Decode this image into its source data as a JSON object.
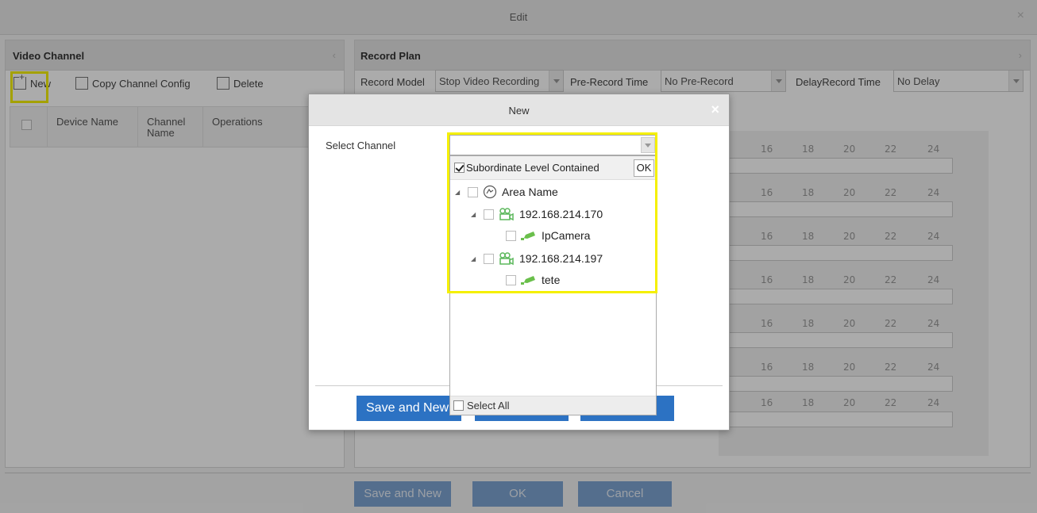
{
  "dialog": {
    "title": "Edit",
    "close": "×"
  },
  "left_panel": {
    "title": "Video Channel",
    "toolbar": {
      "new": "New",
      "copy": "Copy Channel Config",
      "delete": "Delete"
    },
    "columns": [
      "Device Name",
      "Channel Name",
      "Operations"
    ]
  },
  "right_panel": {
    "title": "Record Plan",
    "record_model_label": "Record Model",
    "record_model_value": "Stop Video Recording",
    "pre_record_label": "Pre-Record Time",
    "pre_record_value": "No Pre-Record",
    "delay_label": "DelayRecord Time",
    "delay_value": "No Delay",
    "timeline_ticks": [
      "16",
      "18",
      "20",
      "22",
      "24"
    ]
  },
  "footer": {
    "save_new": "Save and New",
    "ok": "OK",
    "cancel": "Cancel"
  },
  "modal": {
    "title": "New",
    "close": "×",
    "select_channel_label": "Select Channel",
    "save_new": "Save and New"
  },
  "dropdown": {
    "subordinate_label": "Subordinate Level Contained",
    "subordinate_checked": true,
    "ok": "OK",
    "tree": {
      "area": "Area Name",
      "devices": [
        {
          "ip": "192.168.214.170",
          "camera": "IpCamera"
        },
        {
          "ip": "192.168.214.197",
          "camera": "tete"
        }
      ]
    },
    "select_all": "Select All"
  }
}
